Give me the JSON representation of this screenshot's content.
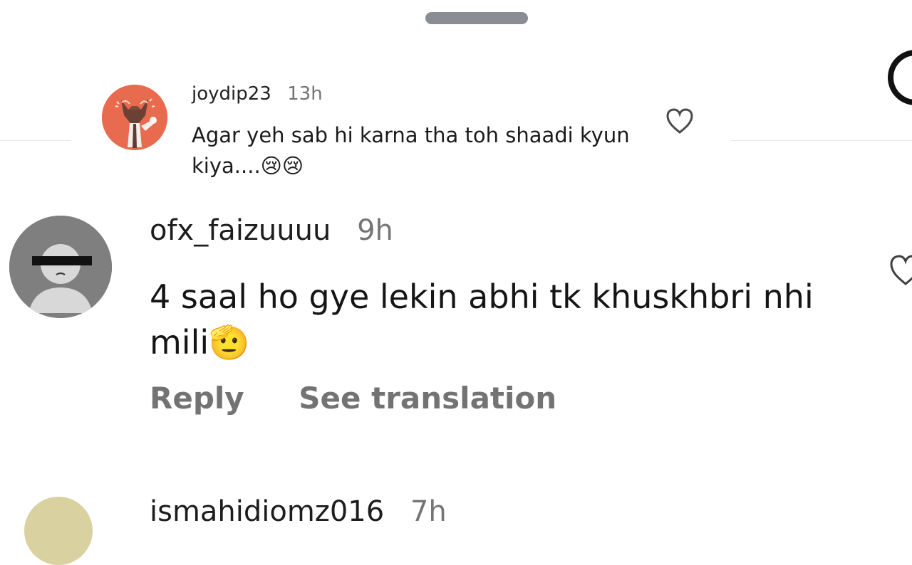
{
  "sheet": {
    "handle_label": "",
    "edge_icon": "partial-circle"
  },
  "quoted_comment": {
    "username": "joydip23",
    "time": "13h",
    "text": "Agar yeh sab hi karna tha toh shaadi kyun kiya....😢😢",
    "avatar": "cartoon-cat-avatar",
    "like_icon": "heart-icon",
    "accent_color": "#e86a4f"
  },
  "comment": {
    "username": "ofx_faizuuuu",
    "time": "9h",
    "text": "4 saal ho gye lekin abhi tk khuskhbri nhi mili🫡",
    "avatar": "default-user-avatar",
    "like_icon": "heart-icon",
    "actions": {
      "reply": "Reply",
      "see_translation": "See translation"
    }
  },
  "next_comment": {
    "username": "ismahidiomz016",
    "time": "7h",
    "avatar": "user-avatar"
  },
  "colors": {
    "background": "#ffffff",
    "username": "#1d1d1d",
    "meta": "#737373",
    "handle": "#8a8d93"
  }
}
